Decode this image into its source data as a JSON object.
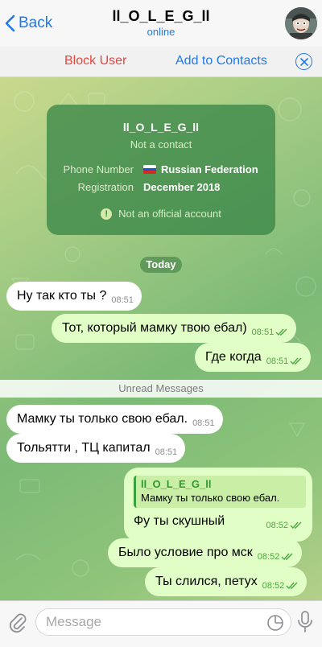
{
  "header": {
    "back_label": "Back",
    "title": "ll_O_L_E_G_ll",
    "status": "online"
  },
  "actions": {
    "block_label": "Block User",
    "add_label": "Add to Contacts"
  },
  "info_card": {
    "name": "ll_O_L_E_G_ll",
    "subtitle": "Not a contact",
    "phone_label": "Phone Number",
    "phone_value": "Russian Federation",
    "reg_label": "Registration",
    "reg_value": "December 2018",
    "note": "Not an official account"
  },
  "date_divider": "Today",
  "unread_label": "Unread Messages",
  "messages": [
    {
      "text": "Ну так кто ты ?",
      "time": "08:51"
    },
    {
      "text": "Тот, который мамку твою ебал)",
      "time": "08:51"
    },
    {
      "text": "Где когда",
      "time": "08:51"
    },
    {
      "text": "Мамку ты только свою ебал.",
      "time": "08:51"
    },
    {
      "text": "Тольятти , ТЦ капитал",
      "time": "08:51"
    },
    {
      "text": "Было условие про мск",
      "time": "08:52"
    },
    {
      "text": "Ты слился, петух",
      "time": "08:52"
    }
  ],
  "reply": {
    "quote_name": "ll_O_L_E_G_ll",
    "quote_text": "Мамку ты только свою ебал.",
    "text": "Фу ты скушный",
    "time": "08:52"
  },
  "composer": {
    "placeholder": "Message"
  },
  "colors": {
    "accent": "#1f7ae8",
    "danger": "#e5463e",
    "outgoing_bubble": "#e1fec6",
    "incoming_bubble": "#ffffff"
  }
}
